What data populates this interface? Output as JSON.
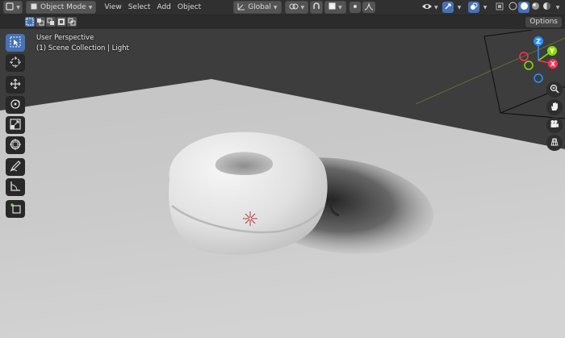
{
  "header": {
    "mode_label": "Object Mode",
    "menus": [
      "View",
      "Select",
      "Add",
      "Object"
    ],
    "orientation_label": "Global"
  },
  "toolbar_row": {
    "options_label": "Options"
  },
  "viewport": {
    "perspective_label": "User Perspective",
    "collection_label": "(1) Scene Collection | Light"
  },
  "gizmo": {
    "axes": [
      "Z",
      "Y",
      "X"
    ]
  },
  "colors": {
    "accent": "#4772b3",
    "axis_x": "#ff3352",
    "axis_y": "#8bdc00",
    "axis_z": "#2890ff",
    "header_bg": "#303030"
  },
  "icons": {
    "editor_type": "cube-icon",
    "tools": [
      "select-box-icon",
      "cursor-icon",
      "move-icon",
      "rotate-icon",
      "scale-icon",
      "transform-icon",
      "annotate-icon",
      "measure-icon",
      "add-cube-icon"
    ],
    "nav": [
      "zoom-icon",
      "hand-icon",
      "camera-icon",
      "grid-icon"
    ]
  }
}
